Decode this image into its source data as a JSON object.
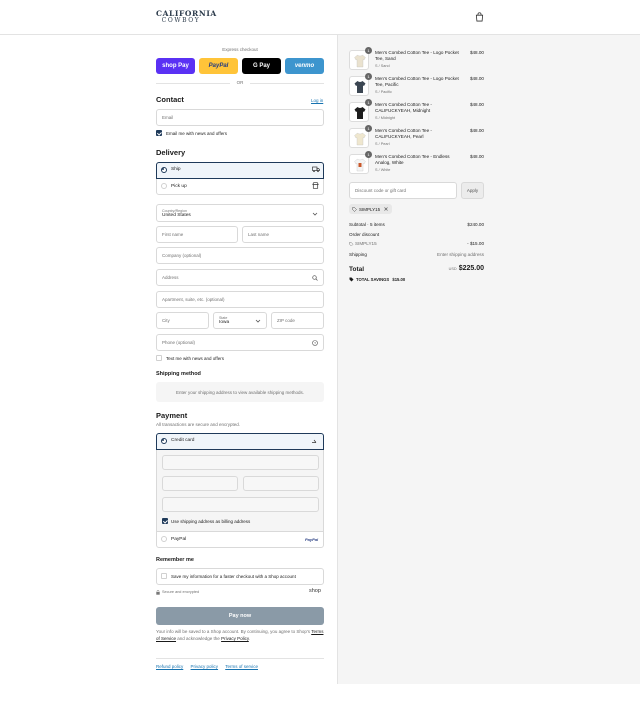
{
  "header": {
    "logo_line1": "CALIFORNIA",
    "logo_line2": "COWBOY"
  },
  "express": {
    "title": "Express checkout",
    "buttons": [
      {
        "label": "shop Pay",
        "color": "#5a31f4"
      },
      {
        "label": "PayPal",
        "color": "#ffc439"
      },
      {
        "label": "G Pay",
        "color": "#000000"
      },
      {
        "label": "venmo",
        "color": "#3d95ce"
      }
    ],
    "or": "OR"
  },
  "contact": {
    "title": "Contact",
    "login": "Log in",
    "email_placeholder": "Email",
    "news_label": "Email me with news and offers"
  },
  "delivery": {
    "title": "Delivery",
    "ship_label": "Ship",
    "pickup_label": "Pick up",
    "country_label": "Country/Region",
    "country_value": "United States",
    "first_name": "First name",
    "last_name": "Last name",
    "company": "Company (optional)",
    "address": "Address",
    "apartment": "Apartment, suite, etc. (optional)",
    "city": "City",
    "state_label": "State",
    "state_value": "Iowa",
    "zip": "ZIP code",
    "phone": "Phone (optional)",
    "text_label": "Text me with news and offers"
  },
  "shipping_method": {
    "title": "Shipping method",
    "note": "Enter your shipping address to view available shipping methods."
  },
  "payment": {
    "title": "Payment",
    "subtitle": "All transactions are secure and encrypted.",
    "credit_card": "Credit card",
    "billing_label": "Use shipping address as billing address",
    "paypal": "PayPal",
    "paypal_logo": "PayPal"
  },
  "remember": {
    "title": "Remember me",
    "save_label": "Save my information for a faster checkout with a Shop account",
    "secure": "Secure and encrypted",
    "shop": "shop"
  },
  "pay_now": "Pay now",
  "legal": {
    "text1": "Your info will be saved to a Shop account. By continuing, you agree to Shop's",
    "tos": "Terms of Service",
    "text2": "and acknowledge the",
    "privacy": "Privacy Policy",
    "dot": "."
  },
  "footer": {
    "refund": "Refund policy",
    "privacy": "Privacy policy",
    "terms": "Terms of service"
  },
  "cart": {
    "items": [
      {
        "name": "Men's Combed Cotton Tee - Logo Pocket Tee, Sand",
        "variant": "S / Sand",
        "price": "$48.00",
        "qty": "1",
        "color": "#eae2cf"
      },
      {
        "name": "Men's Combed Cotton Tee - Logo Pocket Tee, Pacific",
        "variant": "S / Pacific",
        "price": "$48.00",
        "qty": "1",
        "color": "#3b4652"
      },
      {
        "name": "Men's Combed Cotton Tee - CALIFUCKYEAH, Midnight",
        "variant": "S / Midnight",
        "price": "$48.00",
        "qty": "1",
        "color": "#1e1e1e"
      },
      {
        "name": "Men's Combed Cotton Tee - CALIFUCKYEAH, Pearl",
        "variant": "S / Pearl",
        "price": "$48.00",
        "qty": "1",
        "color": "#efe7cf"
      },
      {
        "name": "Men's Combed Cotton Tee - Endless Analog, White",
        "variant": "S / White",
        "price": "$48.00",
        "qty": "1",
        "color": "#f4f4f4"
      }
    ],
    "discount_placeholder": "Discount code or gift card",
    "apply": "Apply",
    "code_chip": "SIMPLY15",
    "subtotal_label": "Subtotal · 5 items",
    "subtotal_value": "$240.00",
    "order_discount": "Order discount",
    "discount_code": "SIMPLY15",
    "discount_value": "- $15.00",
    "shipping_label": "Shipping",
    "shipping_value": "Enter shipping address",
    "total_label": "Total",
    "currency": "USD",
    "total_value": "$225.00",
    "savings_label": "TOTAL SAVINGS",
    "savings_value": "$15.00"
  }
}
